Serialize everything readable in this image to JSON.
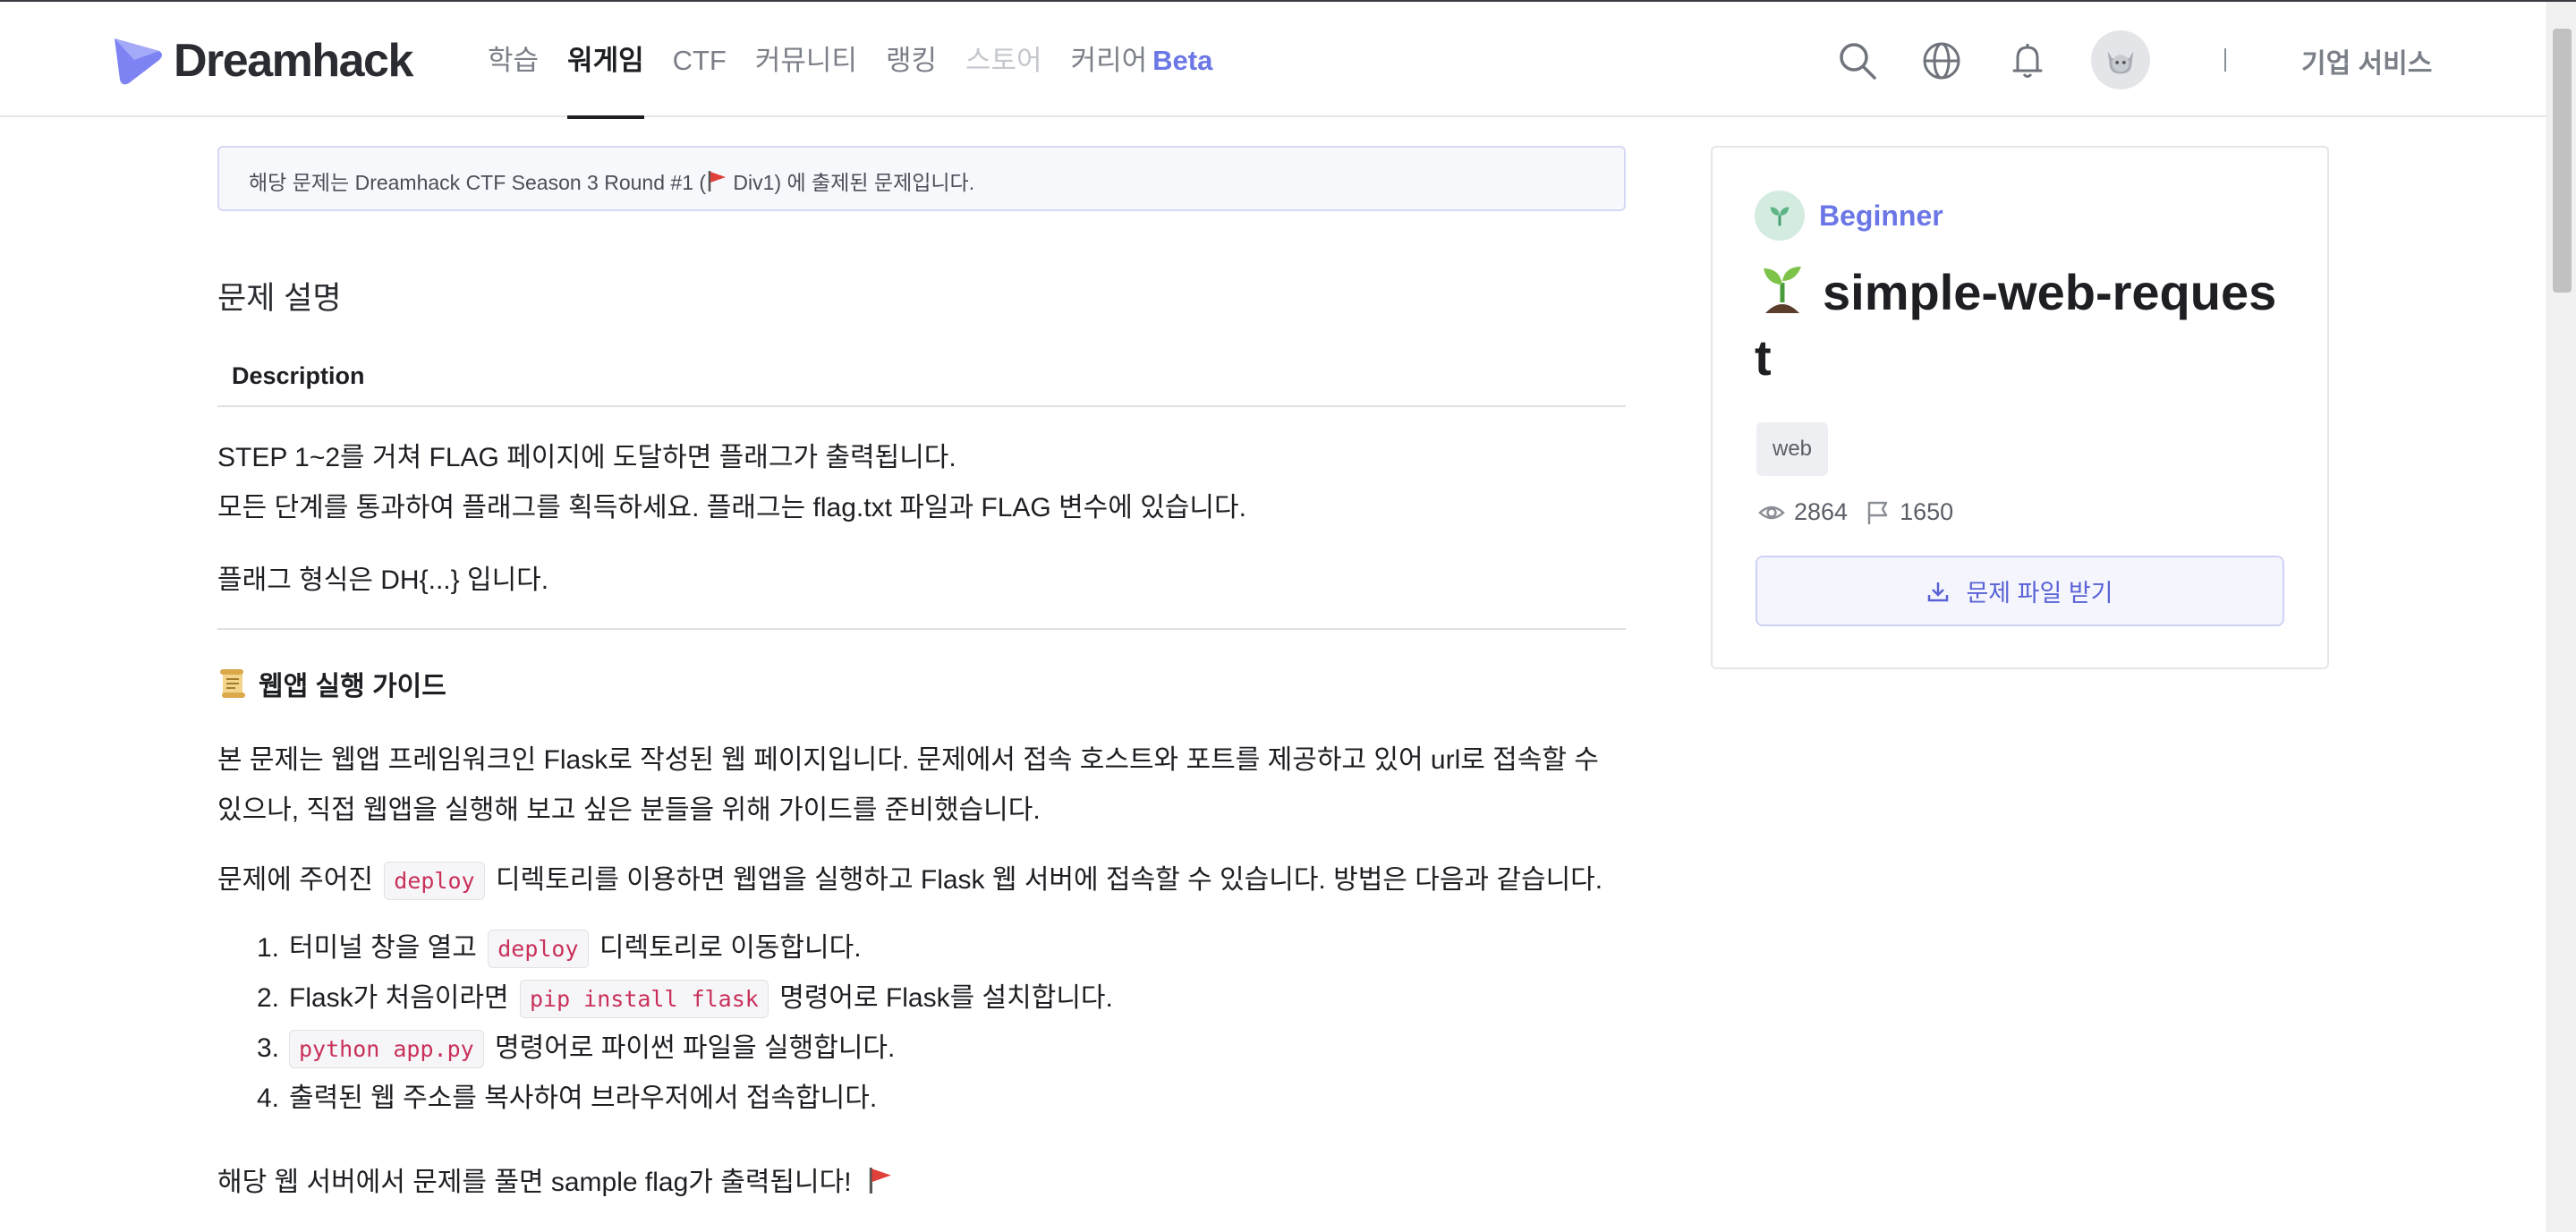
{
  "header": {
    "logo_text": "Dreamhack",
    "nav": [
      {
        "label": "학습"
      },
      {
        "label": "워게임"
      },
      {
        "label": "CTF"
      },
      {
        "label": "커뮤니티"
      },
      {
        "label": "랭킹"
      },
      {
        "label": "스토어"
      },
      {
        "label": "커리어",
        "badge": "Beta"
      }
    ],
    "active_nav": "워게임",
    "separator": "|",
    "business_label": "기업 서비스",
    "icons": [
      "search-icon",
      "globe-icon",
      "bell-icon",
      "avatar"
    ]
  },
  "notice": {
    "text_before": "해당 문제는 Dreamhack CTF Season 3 Round #1 (",
    "text_after": " Div1) 에 출제된 문제입니다."
  },
  "content": {
    "section_title": "문제 설명",
    "description_heading": "Description",
    "desc_line1": "STEP 1~2를 거쳐 FLAG 페이지에 도달하면 플래그가 출력됩니다.",
    "desc_line2": "모든 단계를 통과하여 플래그를 획득하세요. 플래그는 flag.txt 파일과 FLAG 변수에 있습니다.",
    "flag_format": "플래그 형식은 DH{...} 입니다.",
    "guide_title": "웹앱 실행 가이드",
    "guide_p1_line1": "본 문제는 웹앱 프레임워크인 Flask로 작성된 웹 페이지입니다. 문제에서 접속 호스트와 포트를 제공하고 있어 url로 접속할 수",
    "guide_p1_line2": "있으나, 직접 웹앱을 실행해 보고 싶은 분들을 위해 가이드를 준비했습니다.",
    "guide_p2_before": "문제에 주어진",
    "guide_p2_code": "deploy",
    "guide_p2_after": "디렉토리를 이용하면 웹앱을 실행하고 Flask 웹 서버에 접속할 수 있습니다. 방법은 다음과 같습니다.",
    "steps": [
      {
        "num": "1.",
        "before": "터미널 창을 열고",
        "code": "deploy",
        "after": "디렉토리로 이동합니다."
      },
      {
        "num": "2.",
        "before": "Flask가 처음이라면",
        "code": "pip install flask",
        "after": "명령어로 Flask를 설치합니다."
      },
      {
        "num": "3.",
        "before": "",
        "code": "python app.py",
        "after": "명령어로 파이썬 파일을 실행합니다."
      },
      {
        "num": "4.",
        "before": "출력된 웹 주소를 복사하여 브라우저에서 접속합니다.",
        "code": "",
        "after": ""
      }
    ],
    "closing": "해당 웹 서버에서 문제를 풀면 sample flag가 출력됩니다!"
  },
  "card": {
    "level": "Beginner",
    "title": "simple-web-request",
    "tag": "web",
    "views": "2864",
    "solves": "1650",
    "download_label": "문제 파일 받기"
  },
  "colors": {
    "accent": "#6b77e6",
    "code_text": "#c9305a",
    "flag_red": "#e0403a"
  }
}
